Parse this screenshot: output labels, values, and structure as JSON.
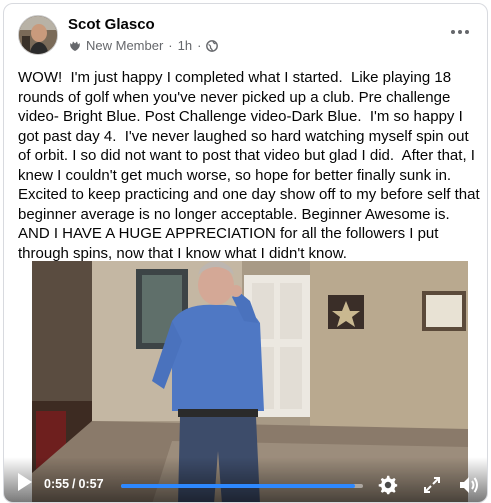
{
  "post": {
    "author": "Scot Glasco",
    "badge_label": "New Member",
    "badge_icon": "new-member-icon",
    "time": "1h",
    "separator": "·",
    "visibility_icon": "globe-icon",
    "more_icon": "more-options-icon",
    "text": "WOW!  I'm just happy I completed what I started.  Like playing 18 rounds of golf when you've never picked up a club. Pre challenge video- Bright Blue. Post Challenge video-Dark Blue.  I'm so happy I got past day 4.  I've never laughed so hard watching myself spin out of orbit. I so did not want to post that video but glad I did.  After that, I knew I couldn't get much worse, so hope for better finally sunk in.  Excited to keep practicing and one day show off to my before self that beginner average is no longer acceptable. Beginner Awesome is. AND I HAVE A HUGE APPRECIATION for all the followers I put through spins, now that I know what I didn't know."
  },
  "video": {
    "current_time": "0:55",
    "separator": "/",
    "duration": "0:57",
    "progress_fraction": 0.965,
    "accent_color": "#2d88ff",
    "icons": [
      "play-icon",
      "settings-gear-icon",
      "fullscreen-icon",
      "volume-icon"
    ]
  }
}
